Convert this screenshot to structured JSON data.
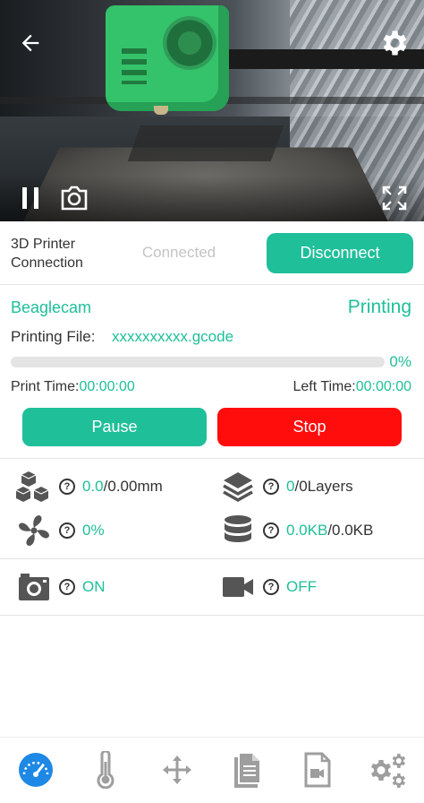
{
  "connection": {
    "label": "3D Printer Connection",
    "status": "Connected",
    "disconnect_label": "Disconnect"
  },
  "printer": {
    "name": "Beaglecam",
    "state": "Printing",
    "file_label": "Printing File:",
    "file_name": "xxxxxxxxxx.gcode",
    "progress_text": "0%",
    "progress_value": 0,
    "print_time_label": "Print Time:",
    "print_time": "00:00:00",
    "left_time_label": "Left Time:",
    "left_time": "00:00:00"
  },
  "actions": {
    "pause_label": "Pause",
    "stop_label": "Stop"
  },
  "stats": {
    "height_current": "0.0",
    "height_total": "/0.00mm",
    "layers_current": "0",
    "layers_total": "/0Layers",
    "fan": "0%",
    "data_current": "0.0KB",
    "data_total": "/0.0KB",
    "camera_state": "ON",
    "video_state": "OFF"
  },
  "icons": {
    "back": "back-arrow-icon",
    "settings": "gear-icon",
    "pause_stream": "pause-icon",
    "snapshot": "camera-icon",
    "fullscreen": "fullscreen-icon",
    "nav": [
      "dashboard-icon",
      "thermometer-icon",
      "move-icon",
      "files-icon",
      "video-file-icon",
      "settings-gears-icon"
    ]
  },
  "colors": {
    "accent": "#1fbf9a",
    "stop": "#ff0d0d",
    "nav_active": "#1e88e5",
    "nav_inactive": "#9e9e9e"
  }
}
